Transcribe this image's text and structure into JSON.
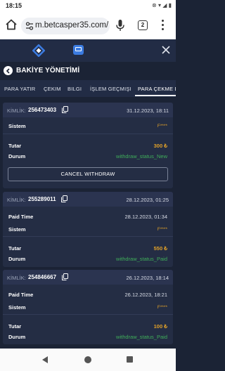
{
  "status_bar": {
    "time": "18:15",
    "icons": "⊗ ▾ ◢ ▮"
  },
  "browser": {
    "url": "m.betcasper35.com/",
    "tab_count": "2"
  },
  "header": {
    "title": "BAKİYE YÖNETİMİ"
  },
  "tabs": [
    {
      "label": "PARA YATIR"
    },
    {
      "label": "ÇEKIM"
    },
    {
      "label": "BILGI"
    },
    {
      "label": "İŞLEM GEÇMIŞI"
    },
    {
      "label": "PARA ÇEKME DURUMU",
      "active": true
    }
  ],
  "kimlik_label": "KİMLİK:",
  "labels": {
    "sistem": "Sistem",
    "tutar": "Tutar",
    "durum": "Durum",
    "paid_time": "Paid Time"
  },
  "withdrawals": [
    {
      "id": "256473403",
      "date": "31.12.2023, 18:11",
      "sistem": "F****",
      "tutar": "300 ₺",
      "durum": "withdraw_status_New",
      "button": "CANCEL WITHDRAW"
    },
    {
      "id": "255289011",
      "date": "28.12.2023, 01:25",
      "paid_time": "28.12.2023, 01:34",
      "sistem": "F****",
      "tutar": "550 ₺",
      "durum": "withdraw_status_Paid"
    },
    {
      "id": "254846667",
      "date": "26.12.2023, 18:14",
      "paid_time": "26.12.2023, 18:21",
      "sistem": "F****",
      "tutar": "100 ₺",
      "durum": "withdraw_status_Paid"
    }
  ],
  "colors": {
    "background": "#1b2335",
    "card": "#242d44",
    "amount": "#e0a029",
    "status": "#3fae5a",
    "accent_blue": "#3b7be0"
  }
}
